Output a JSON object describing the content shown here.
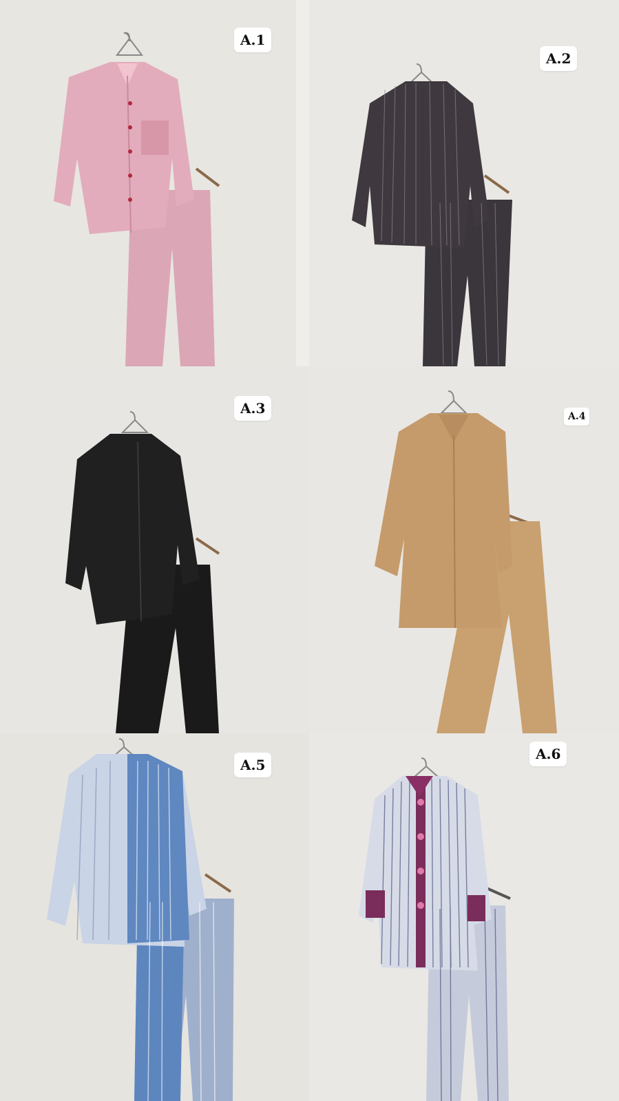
{
  "outfits": [
    {
      "label": "A.1",
      "color": "#d9a3b1"
    },
    {
      "label": "A.2",
      "color": "#3f393f"
    },
    {
      "label": "A.3",
      "color": "#1c1c1d"
    },
    {
      "label": "A.4",
      "color": "#c49a6e"
    },
    {
      "label": "A.5",
      "color": "#5f87c0"
    },
    {
      "label": "A.6",
      "color": "#9ea8c8"
    }
  ]
}
